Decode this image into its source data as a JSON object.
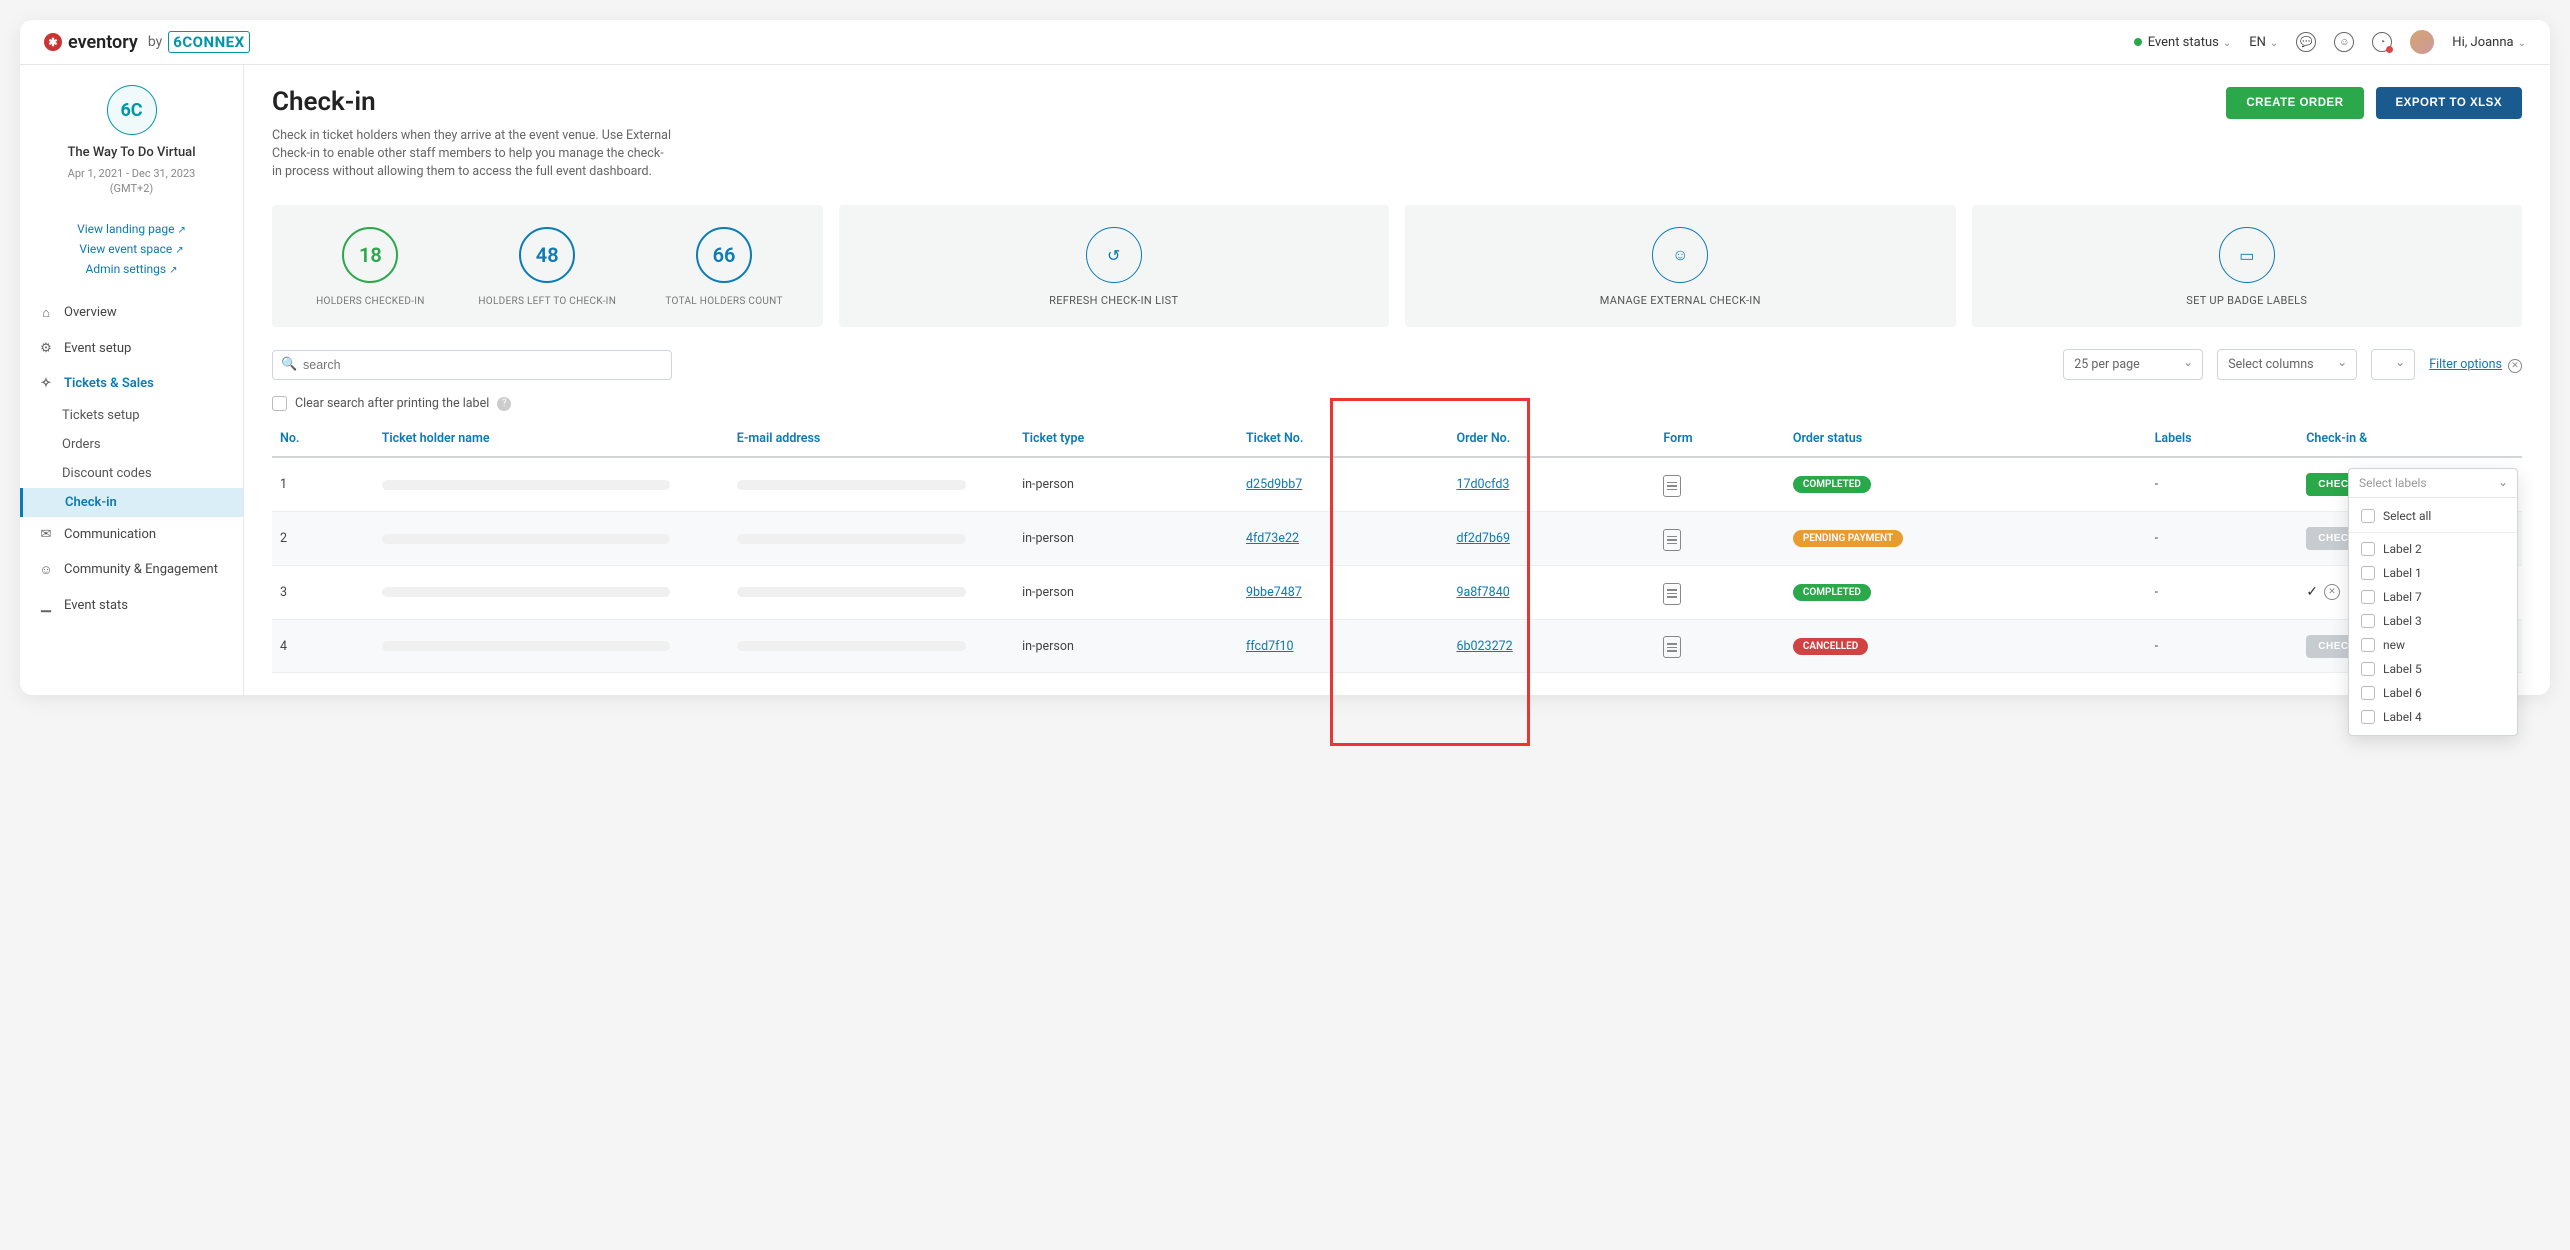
{
  "header": {
    "brand": "eventory",
    "brand_by": "by",
    "brand_partner": "6CONNEX",
    "event_status": "Event status",
    "language": "EN",
    "greeting": "Hi, Joanna"
  },
  "sidebar": {
    "event_name": "The Way To Do Virtual",
    "event_dates": "Apr 1, 2021 - Dec 31, 2023",
    "event_tz": "(GMT+2)",
    "links": {
      "landing": "View landing page",
      "space": "View event space",
      "admin": "Admin settings"
    },
    "nav": {
      "overview": "Overview",
      "setup": "Event setup",
      "tickets": "Tickets & Sales",
      "communication": "Communication",
      "community": "Community & Engagement",
      "stats": "Event stats"
    },
    "sub": {
      "tickets_setup": "Tickets setup",
      "orders": "Orders",
      "discount": "Discount codes",
      "checkin": "Check-in"
    }
  },
  "page": {
    "title": "Check-in",
    "description": "Check in ticket holders when they arrive at the event venue. Use External Check-in to enable other staff members to help you manage the check-in process without allowing them to access the full event dashboard.",
    "create_order": "CREATE ORDER",
    "export": "EXPORT TO XLSX"
  },
  "stats": {
    "checked_in": {
      "value": "18",
      "label": "HOLDERS CHECKED-IN"
    },
    "left": {
      "value": "48",
      "label": "HOLDERS LEFT TO CHECK-IN"
    },
    "total": {
      "value": "66",
      "label": "TOTAL HOLDERS COUNT"
    },
    "refresh": "REFRESH CHECK-IN LIST",
    "manage": "MANAGE EXTERNAL CHECK-IN",
    "badges": "SET UP BADGE LABELS"
  },
  "toolbar": {
    "search_placeholder": "search",
    "per_page": "25 per page",
    "select_columns": "Select columns",
    "filter_options": "Filter options"
  },
  "clear_search": "Clear search after printing the label",
  "columns": {
    "no": "No.",
    "name": "Ticket holder name",
    "email": "E-mail address",
    "type": "Ticket type",
    "ticket_no": "Ticket No.",
    "order_no": "Order No.",
    "form": "Form",
    "status": "Order status",
    "labels": "Labels",
    "checkin": "Check-in &"
  },
  "rows": [
    {
      "no": "1",
      "type": "in-person",
      "ticket": "d25d9bb7",
      "order": "17d0cfd3",
      "status": "COMPLETED",
      "status_class": "completed",
      "labels": "-",
      "action": "CHECK",
      "action_class": ""
    },
    {
      "no": "2",
      "type": "in-person",
      "ticket": "4fd73e22",
      "order": "df2d7b69",
      "status": "PENDING PAYMENT",
      "status_class": "pending",
      "labels": "-",
      "action": "CHEC",
      "action_class": "muted"
    },
    {
      "no": "3",
      "type": "in-person",
      "ticket": "9bbe7487",
      "order": "9a8f7840",
      "status": "COMPLETED",
      "status_class": "completed",
      "labels": "-",
      "action": "icons",
      "action_class": ""
    },
    {
      "no": "4",
      "type": "in-person",
      "ticket": "ffcd7f10",
      "order": "6b023272",
      "status": "CANCELLED",
      "status_class": "cancelled",
      "labels": "-",
      "action": "CHEC",
      "action_class": "muted"
    }
  ],
  "filter_panel": {
    "select_labels": "Select labels",
    "select_all": "Select all",
    "items": [
      "Label 2",
      "Label 1",
      "Label 7",
      "Label 3",
      "new",
      "Label 5",
      "Label 6",
      "Label 4"
    ]
  }
}
